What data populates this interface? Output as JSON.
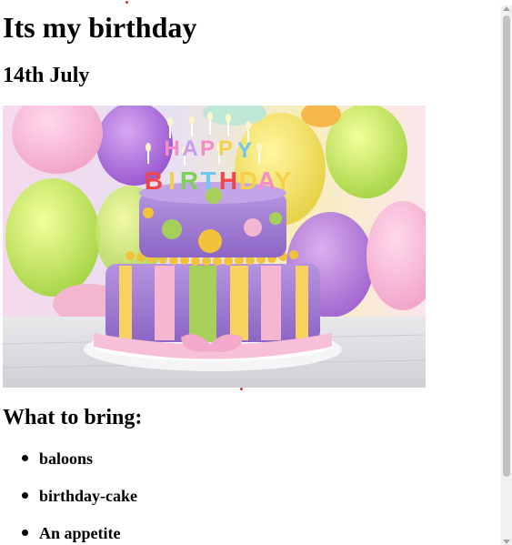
{
  "page": {
    "title": "Its my birthday",
    "date": "14th July"
  },
  "hero_image": {
    "icon": "birthday-cake-image",
    "lettering": "HAPPY BIRTHDAY"
  },
  "bring": {
    "heading": "What to bring:",
    "items": [
      "baloons",
      "birthday-cake",
      "An appetite"
    ]
  },
  "colors": {
    "text": "#000000",
    "background": "#ffffff",
    "scrollbar_track": "#f1f1f1",
    "scrollbar_thumb": "#c1c1c1",
    "marker": "#d32f2f"
  }
}
